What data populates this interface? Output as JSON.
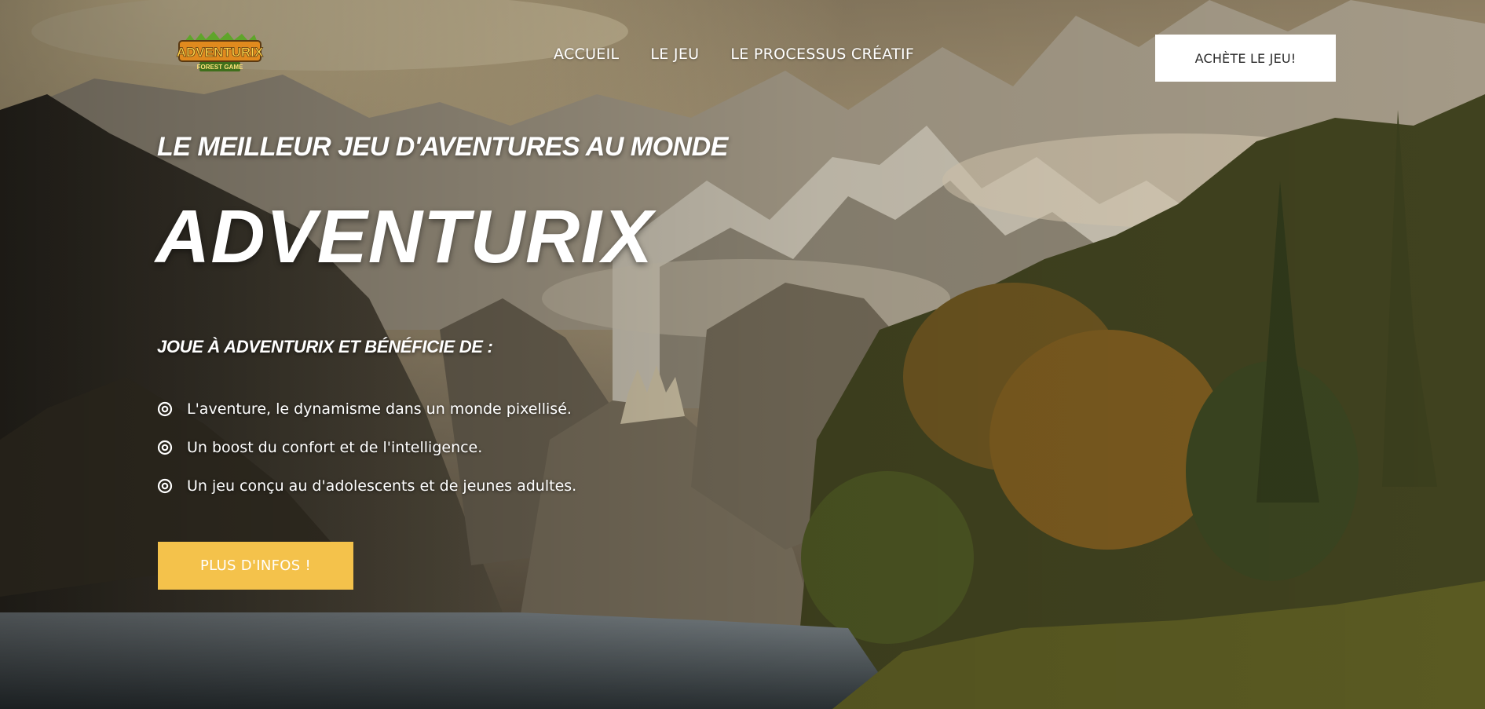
{
  "logo": {
    "text": "ADVENTURIX",
    "tagline": "FOREST GAME"
  },
  "nav": {
    "items": [
      {
        "label": "ACCUEIL"
      },
      {
        "label": "LE JEU"
      },
      {
        "label": "LE PROCESSUS CRÉATIF"
      }
    ],
    "buy_label": "ACHÈTE LE JEU!"
  },
  "hero": {
    "subtitle": "LE MEILLEUR JEU D'AVENTURES AU MONDE",
    "title": "ADVENTURIX",
    "benefits_heading": "JOUE À ADVENTURIX ET BÉNÉFICIE DE :",
    "benefits": [
      "L'aventure, le dynamisme dans un monde pixellisé.",
      "Un boost du confort et de l'intelligence.",
      "Un jeu conçu au d'adolescents et de jeunes adultes."
    ],
    "cta_label": "PLUS D'INFOS !"
  },
  "icons": {
    "bullet": "target-icon"
  },
  "colors": {
    "accent": "#f4c24b",
    "button_light": "#ffffff",
    "text": "#ffffff"
  }
}
